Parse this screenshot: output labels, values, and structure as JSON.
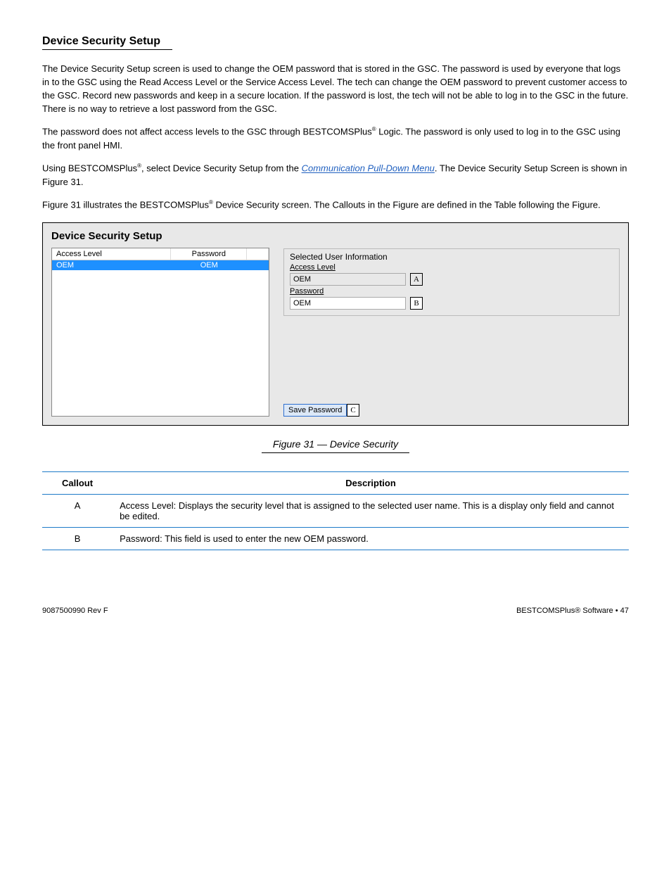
{
  "doc": {
    "page_title": "Device Security Setup",
    "para1": "The Device Security Setup screen is used to change the OEM password that is stored in the GSC. The password is used by everyone that logs in to the GSC using the Read Access Level or the Service Access Level. The tech can change the OEM password to prevent customer access to the GSC. Record new passwords and keep in a secure location. If the password is lost, the tech will not be able to log in to the GSC in the future. There is no way to retrieve a lost password from the GSC.",
    "para2_a": "The password does not affect access levels to the GSC through BESTCOMSPlus",
    "para2_b": " Logic. The password is only used to log in to the GSC using the front panel HMI.",
    "link_text": "Communication Pull-Down Menu",
    "para3_a": "Using BESTCOMSPlus",
    "para3_b": ", select Device Security Setup from the ",
    "para3_c": ". The Device Security Setup Screen is shown in Figure 31.",
    "para_figref_a": "Figure 31",
    "para_figref_b": " illustrates the BESTCOMSPlus",
    "para_figref_c": " Device Security screen. The Callouts in the Figure are defined in the Table following the Figure.",
    "reg": "®"
  },
  "figure": {
    "panel_title": "Device Security Setup",
    "grid": {
      "col1": "Access Level",
      "col2": "Password",
      "row_level": "OEM",
      "row_pw": "OEM"
    },
    "group_title": "Selected User Information",
    "access_label": "Access Level",
    "access_value": "OEM",
    "password_label": "Password",
    "password_value": "OEM",
    "save_button": "Save Password",
    "marker_a": "A",
    "marker_b": "B",
    "marker_c": "C",
    "caption": "Figure 31 — Device Security"
  },
  "table": {
    "h1": "Callout",
    "h2": "Description",
    "rows": [
      {
        "c": "A",
        "d": "Access Level: Displays the security level that is assigned to the selected user name. This is a display only field and cannot be edited."
      },
      {
        "c": "B",
        "d": "Password: This field is used to enter the new OEM password."
      }
    ]
  },
  "footer": {
    "left": "9087500990 Rev F",
    "right": "BESTCOMSPlus® Software • 47"
  }
}
